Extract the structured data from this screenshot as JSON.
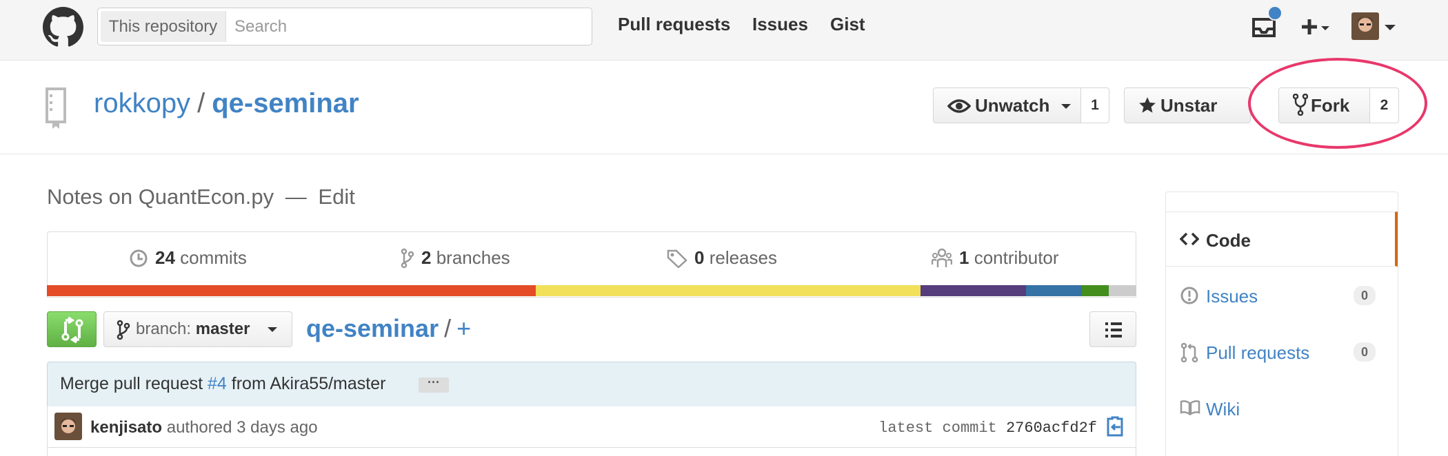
{
  "header": {
    "search_scope": "This repository",
    "search_placeholder": "Search",
    "nav": [
      "Pull requests",
      "Issues",
      "Gist"
    ],
    "icons": [
      "octocat-logo",
      "inbox-icon",
      "plus-icon",
      "avatar"
    ]
  },
  "repo": {
    "owner": "rokkopy",
    "separator": "/",
    "name": "qe-seminar",
    "watch_label": "Unwatch",
    "watch_count": "1",
    "star_label": "Unstar",
    "fork_label": "Fork",
    "fork_count": "2"
  },
  "summary": {
    "description": "Notes on QuantEcon.py",
    "dash": "—",
    "edit_label": "Edit",
    "commits_count": "24",
    "commits_label": "commits",
    "branches_count": "2",
    "branches_label": "branches",
    "releases_count": "0",
    "releases_label": "releases",
    "contributors_count": "1",
    "contributors_label": "contributor",
    "languages": [
      {
        "color": "#e34c26",
        "share": 0.449
      },
      {
        "color": "#f1e05a",
        "share": 0.353
      },
      {
        "color": "#563d7c",
        "share": 0.097
      },
      {
        "color": "#3572a5",
        "share": 0.051
      },
      {
        "color": "#438e1d",
        "share": 0.025
      },
      {
        "color": "#cccccc",
        "share": 0.025
      }
    ]
  },
  "filebar": {
    "branch_prefix": "branch:",
    "branch_name": "master",
    "path_repo": "qe-seminar",
    "path_sep": "/",
    "path_add": "+"
  },
  "commit": {
    "msg_prefix": "Merge pull request",
    "pr_link": "#4",
    "msg_suffix": "from Akira55/master",
    "ellipsis": "···",
    "author": "kenjisato",
    "authored": "authored 3 days ago",
    "latest_label": "latest commit",
    "sha": "2760acfd2f"
  },
  "sidebar": {
    "items": [
      {
        "label": "Code"
      },
      {
        "label": "Issues",
        "count": "0"
      },
      {
        "label": "Pull requests",
        "count": "0"
      },
      {
        "label": "Wiki"
      }
    ]
  },
  "colors": {
    "link": "#4183c4",
    "annotation": "#e8386b",
    "selected_tab": "#d26911",
    "pr_button": "#60b044"
  }
}
